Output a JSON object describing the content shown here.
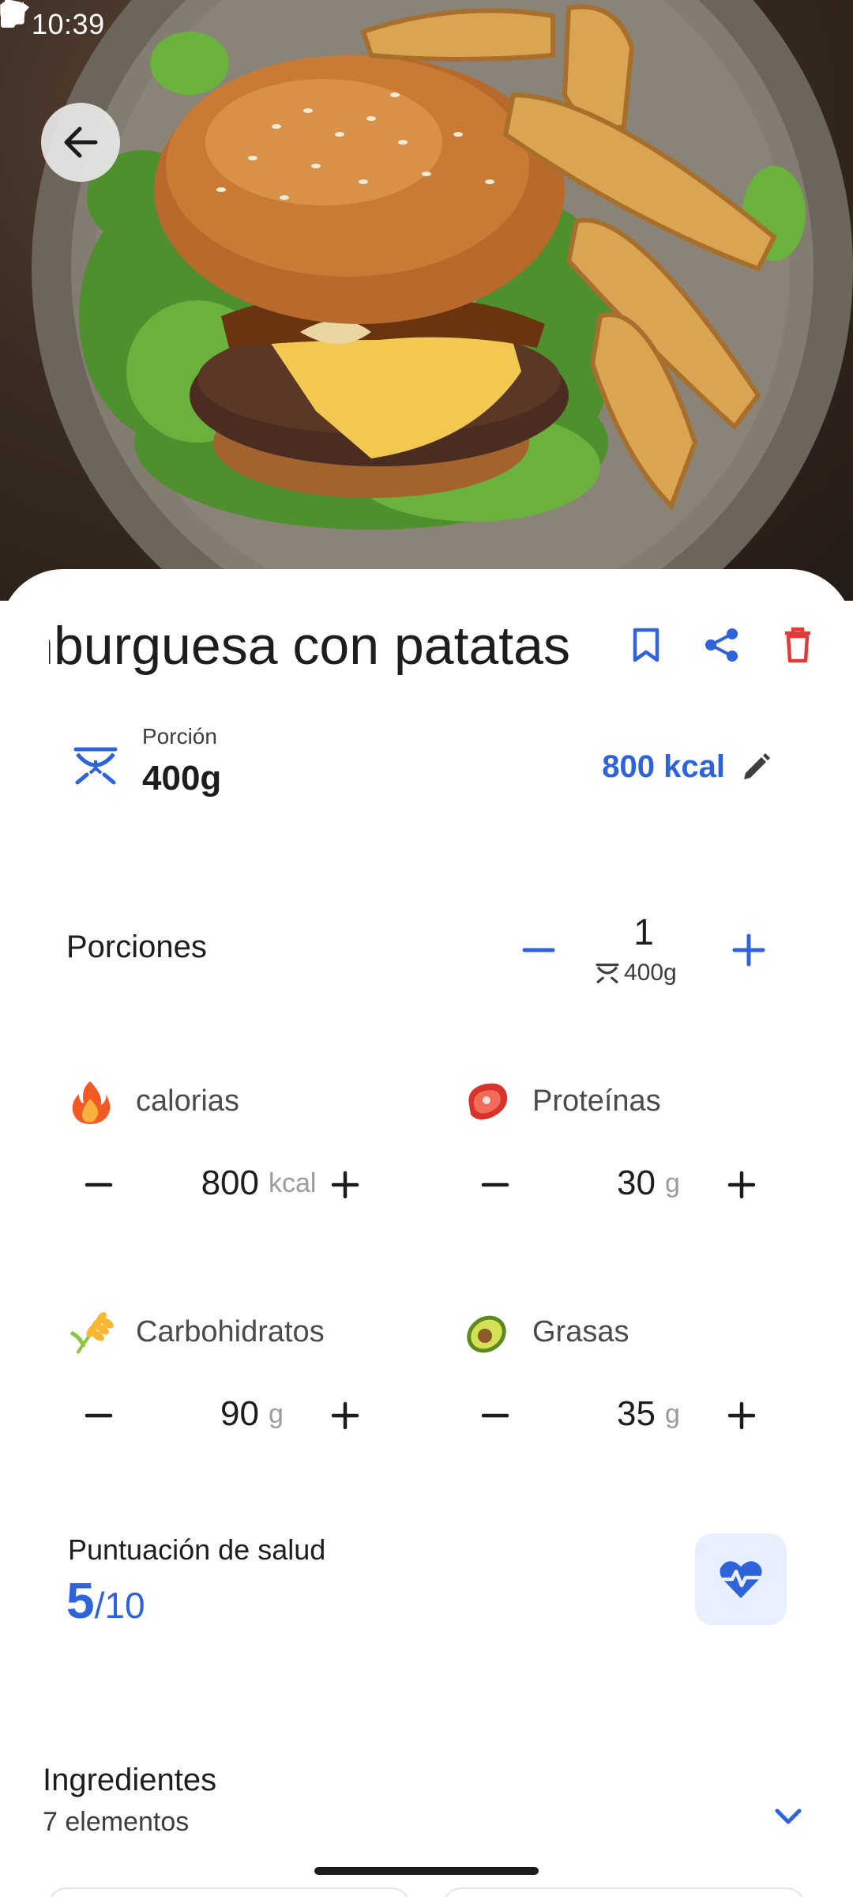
{
  "status_bar": {
    "time": "10:39",
    "left_icons": [
      "google-g-icon",
      "gear-icon",
      "shield-icon",
      "calendar-icon",
      "dot-icon"
    ],
    "right_icons": [
      "wifi-icon",
      "cell-signal-icon",
      "battery-icon"
    ]
  },
  "hero": {
    "image": "burger-with-potato-wedges-photo"
  },
  "header": {
    "back_icon": "arrow-left-icon",
    "title": "Hamburguesa con patatas",
    "actions": [
      "bookmark-icon",
      "share-icon",
      "trash-icon"
    ]
  },
  "portion": {
    "label": "Porción",
    "value": "400g",
    "kcal": "800 kcal",
    "icon": "scale-icon",
    "edit_icon": "pencil-icon"
  },
  "servings": {
    "label": "Porciones",
    "count": "1",
    "weight": "400g"
  },
  "nutrients": [
    {
      "name": "calorias",
      "value": "800",
      "unit": "kcal",
      "icon": "fire-emoji"
    },
    {
      "name": "Proteínas",
      "value": "30",
      "unit": "g",
      "icon": "meat-emoji"
    },
    {
      "name": "Carbohidratos",
      "value": "90",
      "unit": "g",
      "icon": "wheat-emoji"
    },
    {
      "name": "Grasas",
      "value": "35",
      "unit": "g",
      "icon": "avocado-emoji"
    }
  ],
  "health": {
    "label": "Puntuación de salud",
    "score": "5",
    "denominator": "/10",
    "icon": "heart-pulse-icon"
  },
  "ingredients": {
    "title": "Ingredientes",
    "count": "7 elementos",
    "icon": "chevron-down-icon"
  },
  "colors": {
    "accent_blue": "#2e63db",
    "danger_red": "#e53935",
    "health_button_bg": "#e8efff"
  }
}
